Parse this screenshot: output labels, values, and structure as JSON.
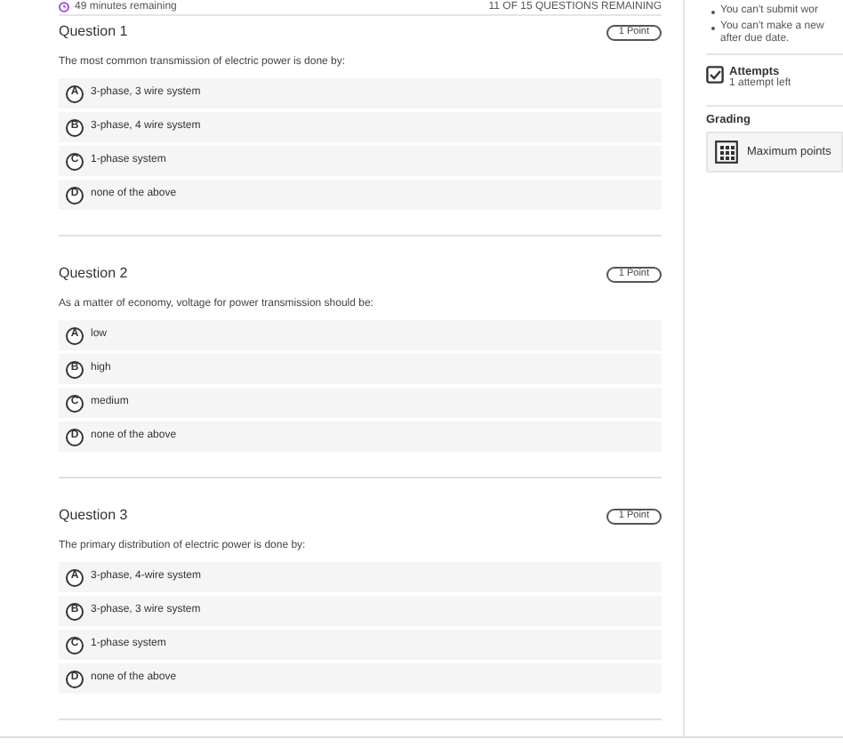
{
  "status": {
    "time_remaining": "49 minutes remaining",
    "questions_remaining": "11 OF 15 QUESTIONS REMAINING"
  },
  "questions": [
    {
      "title": "Question 1",
      "points": "1 Point",
      "text": "The most common transmission of electric power is done by:",
      "options": [
        {
          "letter": "A",
          "label": "3-phase, 3 wire system",
          "selected": false
        },
        {
          "letter": "B",
          "label": "3-phase, 4 wire system",
          "selected": false
        },
        {
          "letter": "C",
          "label": "1-phase system",
          "selected": false
        },
        {
          "letter": "D",
          "label": "none of the above",
          "selected": false
        }
      ]
    },
    {
      "title": "Question 2",
      "points": "1 Point",
      "text": "As a matter of economy, voltage for power transmission should be:",
      "options": [
        {
          "letter": "A",
          "label": "low",
          "selected": false
        },
        {
          "letter": "B",
          "label": "high",
          "selected": false
        },
        {
          "letter": "C",
          "label": "medium",
          "selected": false
        },
        {
          "letter": "D",
          "label": "none of the above",
          "selected": false
        }
      ]
    },
    {
      "title": "Question 3",
      "points": "1 Point",
      "text": "The primary distribution of electric power is done by:",
      "options": [
        {
          "letter": "A",
          "label": "3-phase, 4-wire system",
          "selected": false
        },
        {
          "letter": "B",
          "label": "3-phase, 3 wire system",
          "selected": false
        },
        {
          "letter": "C",
          "label": "1-phase system",
          "selected": false
        },
        {
          "letter": "D",
          "label": "none of the above",
          "selected": false
        }
      ]
    }
  ],
  "sidebar": {
    "notes": [
      "You can't submit wor",
      "You can't make a new after due date."
    ],
    "attempts": {
      "title": "Attempts",
      "value": "1 attempt left"
    },
    "grading": {
      "title": "Grading",
      "method": "Maximum points"
    }
  }
}
